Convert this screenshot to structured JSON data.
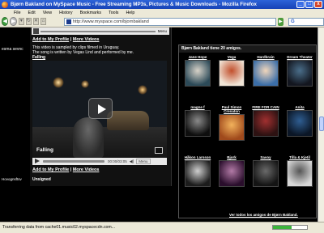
{
  "window": {
    "title": "Bjørn Bakland on MySpace Music - Free Streaming MP3s, Pictures & Music Downloads - Mozilla Firefox",
    "min_label": "_",
    "max_label": "□",
    "close_label": "x"
  },
  "menu": [
    "File",
    "Edit",
    "View",
    "History",
    "Bookmarks",
    "Tools",
    "Help"
  ],
  "nav": {
    "back_label": "◀",
    "forward_label": "▶",
    "url": "http://www.myspace.com/bjornbakland",
    "go_label": "▶",
    "search_brand": "G",
    "search_placeholder": ""
  },
  "sidebar": {
    "left_text_top": "esma sevnc",
    "left_text_bottom": "Hovognsftsv"
  },
  "video_panel": {
    "top_menu": "Menu",
    "add_links": [
      "Add to My Profile",
      "More Videos"
    ],
    "separator": "|",
    "desc_line1": "This video is sampled by clips filmed in Uruguay.",
    "desc_line2": "The song is written by Vegas Lind and performed by me.",
    "video_title": "Falling",
    "video_caption": "Falling",
    "time": "00:00/03:05",
    "menu_label": "Menu",
    "unsigned": "Unsigned"
  },
  "friends": {
    "header": "Bjørn Bakland tiene 20 amigos.",
    "items": [
      {
        "name": "Jane Hope",
        "color1": "#2c4a58",
        "color2": "#d7d2c8"
      },
      {
        "name": "Vega",
        "color1": "#f0e4d6",
        "color2": "#c24f2c"
      },
      {
        "name": "Hardbrain",
        "color1": "#3b6ea8",
        "color2": "#f1d6bb"
      },
      {
        "name": "Dream Theater",
        "color1": "#13161f",
        "color2": "#4a6e8a"
      },
      {
        "name": "magne f",
        "color1": "#0e0e0e",
        "color2": "#8a8a8a"
      },
      {
        "name": "Paul Simon Crenaton",
        "color1": "#a04a1c",
        "color2": "#f2b25c"
      },
      {
        "name": "FIRE FOR CAIN",
        "color1": "#2d1212",
        "color2": "#a13030"
      },
      {
        "name": "Anita",
        "color1": "#0b1626",
        "color2": "#2f5e92"
      },
      {
        "name": "Håkon Larsson",
        "color1": "#1c1c1c",
        "color2": "#cfcfcf"
      },
      {
        "name": "Bjork",
        "color1": "#2a0e2c",
        "color2": "#b27aa6"
      },
      {
        "name": "Savoy",
        "color1": "#141414",
        "color2": "#6a6a6a"
      },
      {
        "name": "Tilla & Kjetil",
        "color1": "#d8d8d8",
        "color2": "#555555"
      }
    ],
    "footer": "Ver todos los amigos de Bjørn Bakland."
  },
  "status": {
    "text": "Transferring data from cache01.music02.myspacecdn.com...",
    "progress": 0.55
  }
}
